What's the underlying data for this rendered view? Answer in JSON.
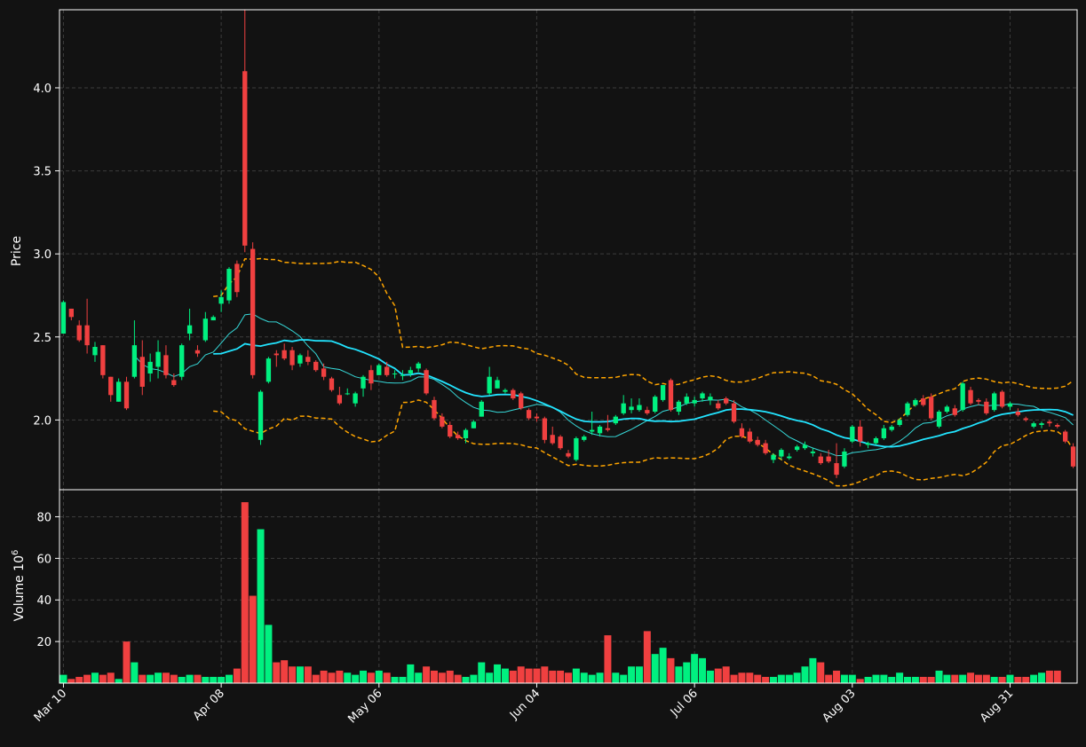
{
  "chart_data": {
    "type": "candlestick",
    "colors": {
      "background": "#121212",
      "up": "#00f080",
      "down": "#f04040",
      "grid": "#3c3c3c",
      "mav_long": "#22e4ff",
      "mav_short": "#36d8d8",
      "bands": "#ffa500",
      "text": "#ffffff"
    },
    "price_panel": {
      "ylabel": "Price",
      "yticks": [
        2.0,
        2.5,
        3.0,
        3.5,
        4.0
      ],
      "ytick_labels": [
        "2.0",
        "2.5",
        "3.0",
        "3.5",
        "4.0"
      ],
      "ylim": [
        1.58,
        4.47
      ],
      "grid": true
    },
    "volume_panel": {
      "ylabel": "Volume  10",
      "ylabel_exponent": "6",
      "yticks": [
        20,
        40,
        60,
        80
      ],
      "ytick_labels": [
        "20",
        "40",
        "60",
        "80"
      ],
      "ylim": [
        0,
        93
      ],
      "grid": true
    },
    "xaxis": {
      "tick_labels": [
        "Mar 10",
        "Apr 08",
        "May 06",
        "Jun 04",
        "Jul 06",
        "Aug 03",
        "Aug 31"
      ],
      "tick_index": [
        0,
        20,
        40,
        60,
        80,
        100,
        120
      ]
    },
    "ohlc": [
      [
        2.52,
        2.72,
        2.52,
        2.71
      ],
      [
        2.67,
        2.67,
        2.6,
        2.62
      ],
      [
        2.57,
        2.6,
        2.47,
        2.48
      ],
      [
        2.57,
        2.73,
        2.4,
        2.45
      ],
      [
        2.39,
        2.47,
        2.35,
        2.44
      ],
      [
        2.45,
        2.45,
        2.25,
        2.27
      ],
      [
        2.26,
        2.26,
        2.11,
        2.15
      ],
      [
        2.11,
        2.25,
        2.11,
        2.23
      ],
      [
        2.23,
        2.26,
        2.06,
        2.07
      ],
      [
        2.26,
        2.6,
        2.25,
        2.45
      ],
      [
        2.38,
        2.48,
        2.15,
        2.2
      ],
      [
        2.28,
        2.4,
        2.23,
        2.35
      ],
      [
        2.32,
        2.48,
        2.25,
        2.41
      ],
      [
        2.39,
        2.45,
        2.25,
        2.27
      ],
      [
        2.24,
        2.28,
        2.2,
        2.21
      ],
      [
        2.26,
        2.46,
        2.24,
        2.45
      ],
      [
        2.52,
        2.67,
        2.48,
        2.57
      ],
      [
        2.42,
        2.45,
        2.38,
        2.4
      ],
      [
        2.48,
        2.65,
        2.47,
        2.61
      ],
      [
        2.6,
        2.63,
        2.6,
        2.62
      ],
      [
        2.7,
        2.78,
        2.65,
        2.74
      ],
      [
        2.72,
        2.92,
        2.7,
        2.91
      ],
      [
        2.94,
        2.96,
        2.74,
        2.77
      ],
      [
        4.1,
        4.47,
        3.01,
        3.05
      ],
      [
        3.03,
        3.07,
        2.25,
        2.27
      ],
      [
        1.88,
        2.18,
        1.85,
        2.17
      ],
      [
        2.23,
        2.38,
        2.22,
        2.37
      ],
      [
        2.4,
        2.42,
        2.32,
        2.39
      ],
      [
        2.42,
        2.46,
        2.36,
        2.37
      ],
      [
        2.42,
        2.44,
        2.3,
        2.33
      ],
      [
        2.34,
        2.4,
        2.32,
        2.39
      ],
      [
        2.38,
        2.42,
        2.33,
        2.35
      ],
      [
        2.35,
        2.36,
        2.29,
        2.3
      ],
      [
        2.31,
        2.34,
        2.24,
        2.26
      ],
      [
        2.25,
        2.26,
        2.17,
        2.18
      ],
      [
        2.15,
        2.2,
        2.09,
        2.1
      ],
      [
        2.16,
        2.19,
        2.15,
        2.16
      ],
      [
        2.1,
        2.17,
        2.08,
        2.16
      ],
      [
        2.19,
        2.27,
        2.14,
        2.26
      ],
      [
        2.3,
        2.33,
        2.18,
        2.22
      ],
      [
        2.27,
        2.34,
        2.27,
        2.33
      ],
      [
        2.32,
        2.35,
        2.26,
        2.27
      ],
      [
        2.28,
        2.3,
        2.25,
        2.28
      ],
      [
        2.27,
        2.3,
        2.24,
        2.27
      ],
      [
        2.28,
        2.32,
        2.26,
        2.3
      ],
      [
        2.31,
        2.35,
        2.29,
        2.34
      ],
      [
        2.3,
        2.31,
        2.15,
        2.16
      ],
      [
        2.12,
        2.14,
        2.0,
        2.01
      ],
      [
        2.02,
        2.04,
        1.95,
        1.96
      ],
      [
        1.97,
        1.99,
        1.89,
        1.9
      ],
      [
        1.91,
        1.93,
        1.88,
        1.89
      ],
      [
        1.89,
        1.95,
        1.86,
        1.94
      ],
      [
        1.95,
        2.0,
        1.95,
        1.99
      ],
      [
        2.02,
        2.12,
        2.02,
        2.11
      ],
      [
        2.16,
        2.32,
        2.15,
        2.26
      ],
      [
        2.19,
        2.26,
        2.19,
        2.24
      ],
      [
        2.17,
        2.19,
        2.16,
        2.18
      ],
      [
        2.18,
        2.19,
        2.12,
        2.13
      ],
      [
        2.16,
        2.17,
        2.06,
        2.07
      ],
      [
        2.06,
        2.07,
        2.0,
        2.01
      ],
      [
        2.02,
        2.04,
        1.99,
        2.01
      ],
      [
        2.01,
        2.02,
        1.86,
        1.88
      ],
      [
        1.91,
        1.96,
        1.85,
        1.86
      ],
      [
        1.9,
        1.91,
        1.82,
        1.83
      ],
      [
        1.8,
        1.82,
        1.77,
        1.78
      ],
      [
        1.76,
        1.9,
        1.75,
        1.89
      ],
      [
        1.88,
        1.91,
        1.87,
        1.9
      ],
      [
        1.93,
        2.05,
        1.91,
        1.94
      ],
      [
        1.92,
        1.97,
        1.9,
        1.96
      ],
      [
        1.95,
        2.03,
        1.93,
        1.94
      ],
      [
        1.98,
        2.03,
        1.97,
        2.02
      ],
      [
        2.04,
        2.15,
        2.03,
        2.1
      ],
      [
        2.06,
        2.13,
        2.04,
        2.08
      ],
      [
        2.06,
        2.13,
        2.05,
        2.09
      ],
      [
        2.06,
        2.08,
        2.03,
        2.04
      ],
      [
        2.05,
        2.15,
        2.04,
        2.14
      ],
      [
        2.12,
        2.2,
        2.11,
        2.21
      ],
      [
        2.24,
        2.25,
        2.05,
        2.06
      ],
      [
        2.05,
        2.12,
        2.03,
        2.11
      ],
      [
        2.1,
        2.16,
        2.09,
        2.14
      ],
      [
        2.1,
        2.14,
        2.08,
        2.12
      ],
      [
        2.13,
        2.17,
        2.11,
        2.16
      ],
      [
        2.12,
        2.16,
        2.09,
        2.14
      ],
      [
        2.1,
        2.12,
        2.06,
        2.07
      ],
      [
        2.13,
        2.14,
        2.09,
        2.1
      ],
      [
        2.1,
        2.12,
        1.98,
        1.99
      ],
      [
        1.95,
        1.98,
        1.89,
        1.9
      ],
      [
        1.93,
        1.95,
        1.86,
        1.87
      ],
      [
        1.88,
        1.9,
        1.84,
        1.85
      ],
      [
        1.86,
        1.88,
        1.79,
        1.8
      ],
      [
        1.76,
        1.8,
        1.74,
        1.79
      ],
      [
        1.78,
        1.83,
        1.76,
        1.82
      ],
      [
        1.77,
        1.8,
        1.76,
        1.78
      ],
      [
        1.82,
        1.85,
        1.81,
        1.84
      ],
      [
        1.83,
        1.87,
        1.82,
        1.85
      ],
      [
        1.8,
        1.83,
        1.78,
        1.81
      ],
      [
        1.78,
        1.8,
        1.73,
        1.74
      ],
      [
        1.78,
        1.82,
        1.74,
        1.75
      ],
      [
        1.74,
        1.86,
        1.65,
        1.67
      ],
      [
        1.72,
        1.83,
        1.71,
        1.81
      ],
      [
        1.87,
        1.97,
        1.86,
        1.96
      ],
      [
        1.96,
        2.0,
        1.84,
        1.87
      ],
      [
        1.85,
        1.87,
        1.83,
        1.86
      ],
      [
        1.86,
        1.9,
        1.85,
        1.89
      ],
      [
        1.89,
        1.97,
        1.88,
        1.95
      ],
      [
        1.94,
        1.97,
        1.93,
        1.96
      ],
      [
        1.97,
        2.01,
        1.96,
        2.0
      ],
      [
        2.03,
        2.11,
        2.02,
        2.1
      ],
      [
        2.09,
        2.13,
        2.08,
        2.12
      ],
      [
        2.13,
        2.15,
        2.08,
        2.09
      ],
      [
        2.14,
        2.16,
        2.0,
        2.01
      ],
      [
        1.96,
        2.06,
        1.95,
        2.05
      ],
      [
        2.05,
        2.09,
        2.04,
        2.08
      ],
      [
        2.07,
        2.09,
        2.02,
        2.03
      ],
      [
        2.06,
        2.23,
        2.05,
        2.22
      ],
      [
        2.18,
        2.2,
        2.09,
        2.1
      ],
      [
        2.12,
        2.13,
        2.09,
        2.11
      ],
      [
        2.11,
        2.13,
        2.03,
        2.04
      ],
      [
        2.06,
        2.17,
        2.05,
        2.16
      ],
      [
        2.17,
        2.18,
        2.07,
        2.08
      ],
      [
        2.08,
        2.11,
        2.06,
        2.1
      ],
      [
        2.05,
        2.07,
        2.02,
        2.03
      ],
      [
        2.01,
        2.02,
        1.99,
        2.0
      ],
      [
        1.96,
        1.99,
        1.95,
        1.98
      ],
      [
        1.97,
        1.99,
        1.95,
        1.98
      ],
      [
        1.99,
        2.0,
        1.96,
        1.98
      ],
      [
        1.97,
        1.98,
        1.95,
        1.96
      ],
      [
        1.93,
        1.94,
        1.86,
        1.87
      ],
      [
        1.84,
        1.86,
        1.71,
        1.72
      ]
    ],
    "volume": [
      4,
      2,
      3,
      4,
      5,
      4,
      5,
      2,
      20,
      10,
      4,
      4,
      5,
      5,
      4,
      3,
      4,
      4,
      3,
      3,
      3,
      4,
      7,
      87,
      42,
      74,
      28,
      10,
      11,
      8,
      8,
      8,
      4,
      6,
      5,
      6,
      5,
      4,
      6,
      5,
      6,
      5,
      3,
      3,
      9,
      5,
      8,
      6,
      5,
      6,
      4,
      3,
      4,
      10,
      5,
      9,
      7,
      6,
      8,
      7,
      7,
      8,
      6,
      6,
      5,
      7,
      5,
      4,
      5,
      23,
      5,
      4,
      8,
      8,
      25,
      14,
      17,
      12,
      8,
      10,
      14,
      12,
      6,
      7,
      8,
      4,
      5,
      5,
      4,
      3,
      3,
      4,
      4,
      5,
      8,
      12,
      10,
      4,
      6,
      4,
      4,
      2,
      3,
      4,
      4,
      3,
      5,
      3,
      3,
      3,
      3,
      6,
      4,
      4,
      4,
      5,
      4,
      4,
      3,
      3,
      4,
      3,
      3,
      4,
      5,
      6,
      6
    ],
    "moving_averages": [
      {
        "period": 10,
        "color": "#36d8d8"
      },
      {
        "period": 20,
        "color": "#22e4ff"
      }
    ],
    "bands": {
      "window": 20,
      "color": "#ffa500",
      "style": "dashed"
    }
  }
}
